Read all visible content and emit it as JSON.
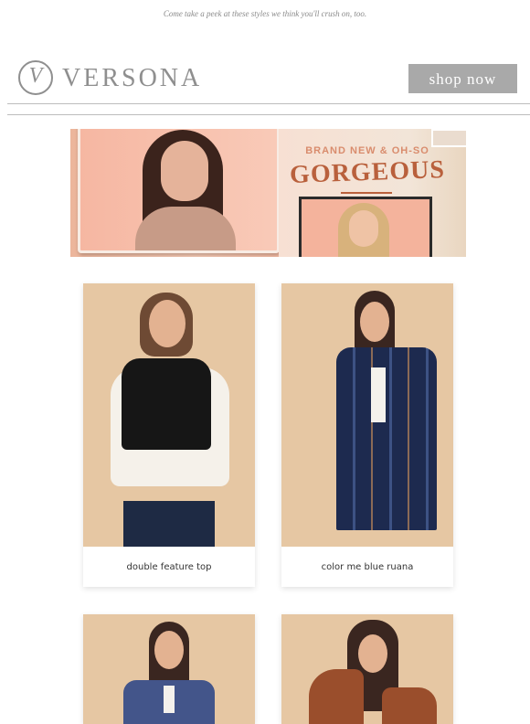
{
  "preheader": "Come take a peek at these styles we think you'll crush on, too.",
  "header": {
    "logo_mark": "V",
    "logo_text": "VERSONA",
    "shop_label": "shop now"
  },
  "hero": {
    "tagline": "BRAND NEW & OH-SO",
    "headline": "GORGEOUS"
  },
  "products": [
    {
      "name": "double feature top"
    },
    {
      "name": "color me blue ruana"
    },
    {
      "name": ""
    },
    {
      "name": ""
    }
  ],
  "colors": {
    "brand_gray": "#8f8f8f",
    "button_bg": "#a9a9a9",
    "hero_accent": "#b9603c",
    "product_bg": "#e6c7a3"
  }
}
